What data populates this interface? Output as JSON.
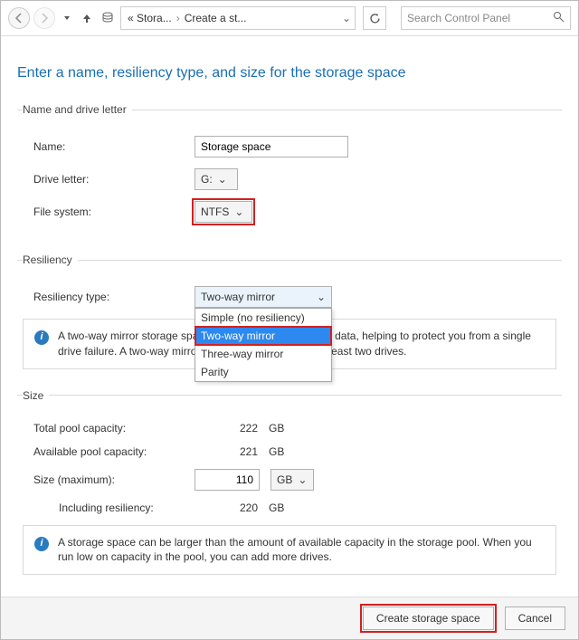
{
  "toolbar": {
    "breadcrumb_start": "« Stora...",
    "breadcrumb_end": "Create a st...",
    "search_placeholder": "Search Control Panel"
  },
  "page_title": "Enter a name, resiliency type, and size for the storage space",
  "groups": {
    "name_drive": {
      "legend": "Name and drive letter",
      "name_label": "Name:",
      "name_value": "Storage space",
      "drive_label": "Drive letter:",
      "drive_value": "G:",
      "fs_label": "File system:",
      "fs_value": "NTFS"
    },
    "resiliency": {
      "legend": "Resiliency",
      "type_label": "Resiliency type:",
      "type_value": "Two-way mirror",
      "options": [
        "Simple (no resiliency)",
        "Two-way mirror",
        "Three-way mirror",
        "Parity"
      ],
      "info": "A two-way mirror storage space writes two copies of your data, helping to protect you from a single drive failure. A two-way mirror storage space requires at least two drives."
    },
    "size": {
      "legend": "Size",
      "total_label": "Total pool capacity:",
      "total_value": "222",
      "total_unit": "GB",
      "avail_label": "Available pool capacity:",
      "avail_value": "221",
      "avail_unit": "GB",
      "size_label": "Size (maximum):",
      "size_value": "110",
      "size_unit": "GB",
      "incl_label": "Including resiliency:",
      "incl_value": "220",
      "incl_unit": "GB",
      "info": "A storage space can be larger than the amount of available capacity in the storage pool. When you run low on capacity in the pool, you can add more drives."
    }
  },
  "footer": {
    "create": "Create storage space",
    "cancel": "Cancel"
  }
}
